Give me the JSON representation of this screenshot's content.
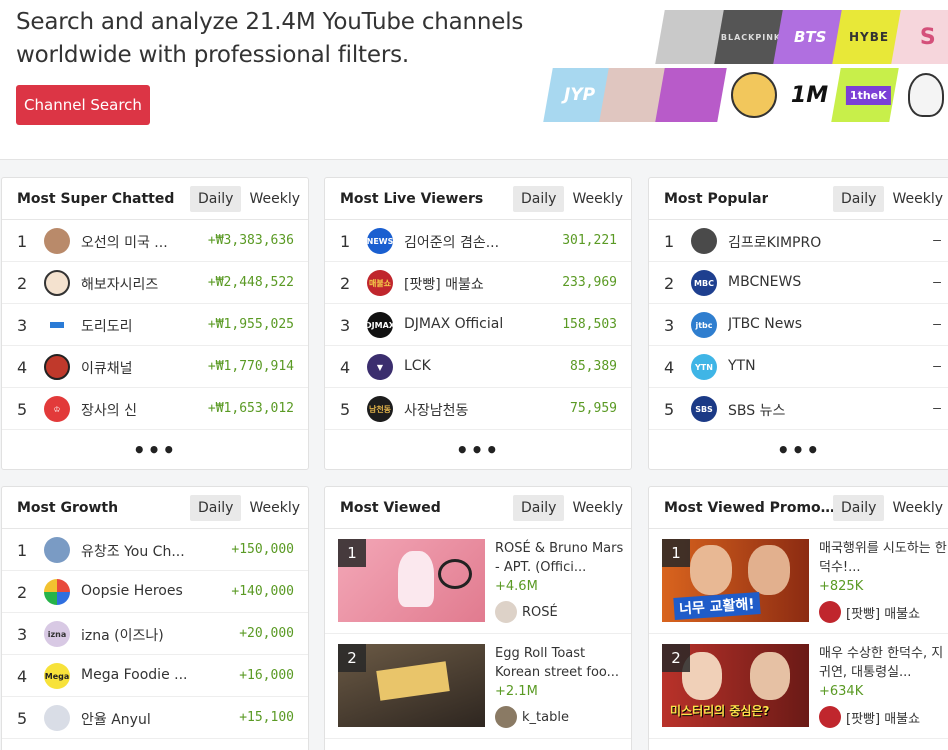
{
  "hero": {
    "title": "Search and analyze 21.4M YouTube channels worldwide with professional filters.",
    "button": "Channel Search",
    "logos": [
      "",
      "BLACKPINK",
      "BTS",
      "HYBE",
      "S",
      "JYP",
      "",
      "",
      "",
      "1M",
      "1theK",
      ""
    ]
  },
  "tabs": {
    "daily": "Daily",
    "weekly": "Weekly"
  },
  "more": "•••",
  "cards": {
    "super_chatted": {
      "title": "Most Super Chatted",
      "rows": [
        {
          "rank": "1",
          "name": "오선의 미국 ...",
          "value": "+₩3,383,636"
        },
        {
          "rank": "2",
          "name": "해보자시리즈",
          "value": "+₩2,448,522"
        },
        {
          "rank": "3",
          "name": "도리도리",
          "value": "+₩1,955,025"
        },
        {
          "rank": "4",
          "name": "이큐채널",
          "value": "+₩1,770,914"
        },
        {
          "rank": "5",
          "name": "장사의 신",
          "value": "+₩1,653,012"
        }
      ]
    },
    "live_viewers": {
      "title": "Most Live Viewers",
      "rows": [
        {
          "rank": "1",
          "name": "김어준의 겸손...",
          "value": "301,221"
        },
        {
          "rank": "2",
          "name": "[팟빵] 매불쇼",
          "value": "233,969"
        },
        {
          "rank": "3",
          "name": "DJMAX Official",
          "value": "158,503"
        },
        {
          "rank": "4",
          "name": "LCK",
          "value": "85,389"
        },
        {
          "rank": "5",
          "name": "사장남천동",
          "value": "75,959"
        }
      ]
    },
    "popular": {
      "title": "Most Popular",
      "rows": [
        {
          "rank": "1",
          "name": "김프로KIMPRO",
          "value": "–"
        },
        {
          "rank": "2",
          "name": "MBCNEWS",
          "value": "–"
        },
        {
          "rank": "3",
          "name": "JTBC News",
          "value": "–"
        },
        {
          "rank": "4",
          "name": "YTN",
          "value": "–"
        },
        {
          "rank": "5",
          "name": "SBS 뉴스",
          "value": "–"
        }
      ]
    },
    "growth": {
      "title": "Most Growth",
      "rows": [
        {
          "rank": "1",
          "name": "유창조 You Ch...",
          "value": "+150,000"
        },
        {
          "rank": "2",
          "name": "Oopsie Heroes",
          "value": "+140,000"
        },
        {
          "rank": "3",
          "name": "izna (이즈나)",
          "value": "+20,000"
        },
        {
          "rank": "4",
          "name": "Mega Foodie ...",
          "value": "+16,000"
        },
        {
          "rank": "5",
          "name": "안율 Anyul",
          "value": "+15,100"
        }
      ]
    },
    "viewed": {
      "title": "Most Viewed",
      "videos": [
        {
          "rank": "1",
          "title": "ROSÉ & Bruno Mars - APT. (Offici...",
          "views": "+4.6M",
          "channel": "ROSÉ"
        },
        {
          "rank": "2",
          "title": "Egg Roll Toast Korean street foo...",
          "views": "+2.1M",
          "channel": "k_table"
        }
      ]
    },
    "promotion": {
      "title": "Most Viewed Promotion...",
      "videos": [
        {
          "rank": "1",
          "title": "매국행위를 시도하는 한덕수!...",
          "views": "+825K",
          "channel": "[팟빵] 매불쇼",
          "thumb_text": "너무 교활해!"
        },
        {
          "rank": "2",
          "title": "매우 수상한 한덕수, 지귀연, 대통령실...",
          "views": "+634K",
          "channel": "[팟빵] 매불쇼",
          "thumb_text": "미스터리의 중심은?"
        }
      ]
    }
  },
  "colors": {
    "accent_red": "#dc3545",
    "positive_green": "#5a9a24"
  }
}
